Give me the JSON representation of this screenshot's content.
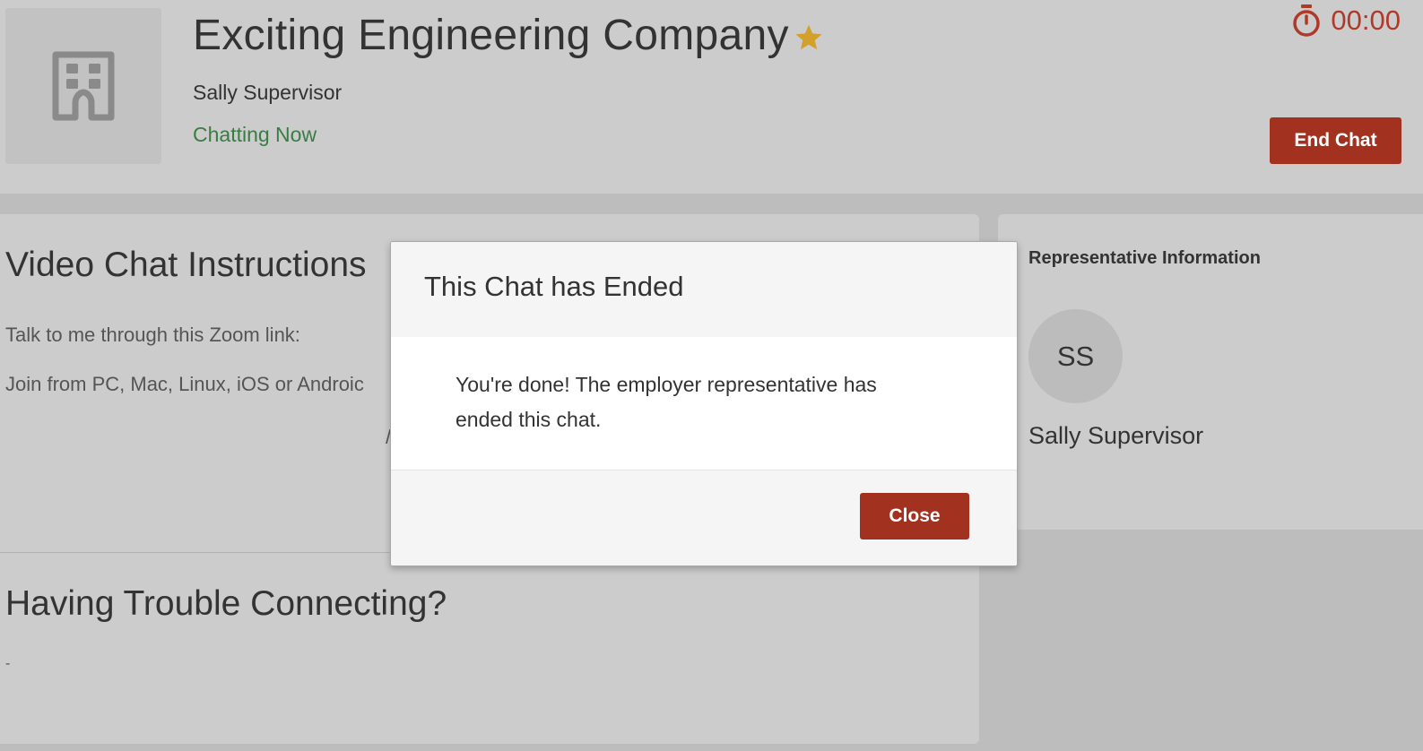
{
  "header": {
    "company_name": "Exciting Engineering Company",
    "representative": "Sally Supervisor",
    "status": "Chatting Now",
    "timer": "00:00",
    "end_chat_label": "End Chat",
    "logo_icon": "building-icon",
    "favorite_icon": "star-icon",
    "timer_icon": "stopwatch-icon"
  },
  "instructions": {
    "title": "Video Chat Instructions",
    "line1": "Talk to me through this Zoom link:",
    "line2": "Join from PC, Mac, Linux, iOS or Androic",
    "fragment": "/"
  },
  "trouble": {
    "title": "Having Trouble Connecting?",
    "text": "-"
  },
  "rep_info": {
    "title": "Representative Information",
    "initials": "SS",
    "name": "Sally Supervisor"
  },
  "modal": {
    "title": "This Chat has Ended",
    "message": "You're done! The employer representative has ended this chat.",
    "close_label": "Close"
  },
  "colors": {
    "accent": "#a3311f",
    "status_green": "#3a7d44",
    "star": "#d4a02c",
    "timer": "#b03a2a"
  }
}
